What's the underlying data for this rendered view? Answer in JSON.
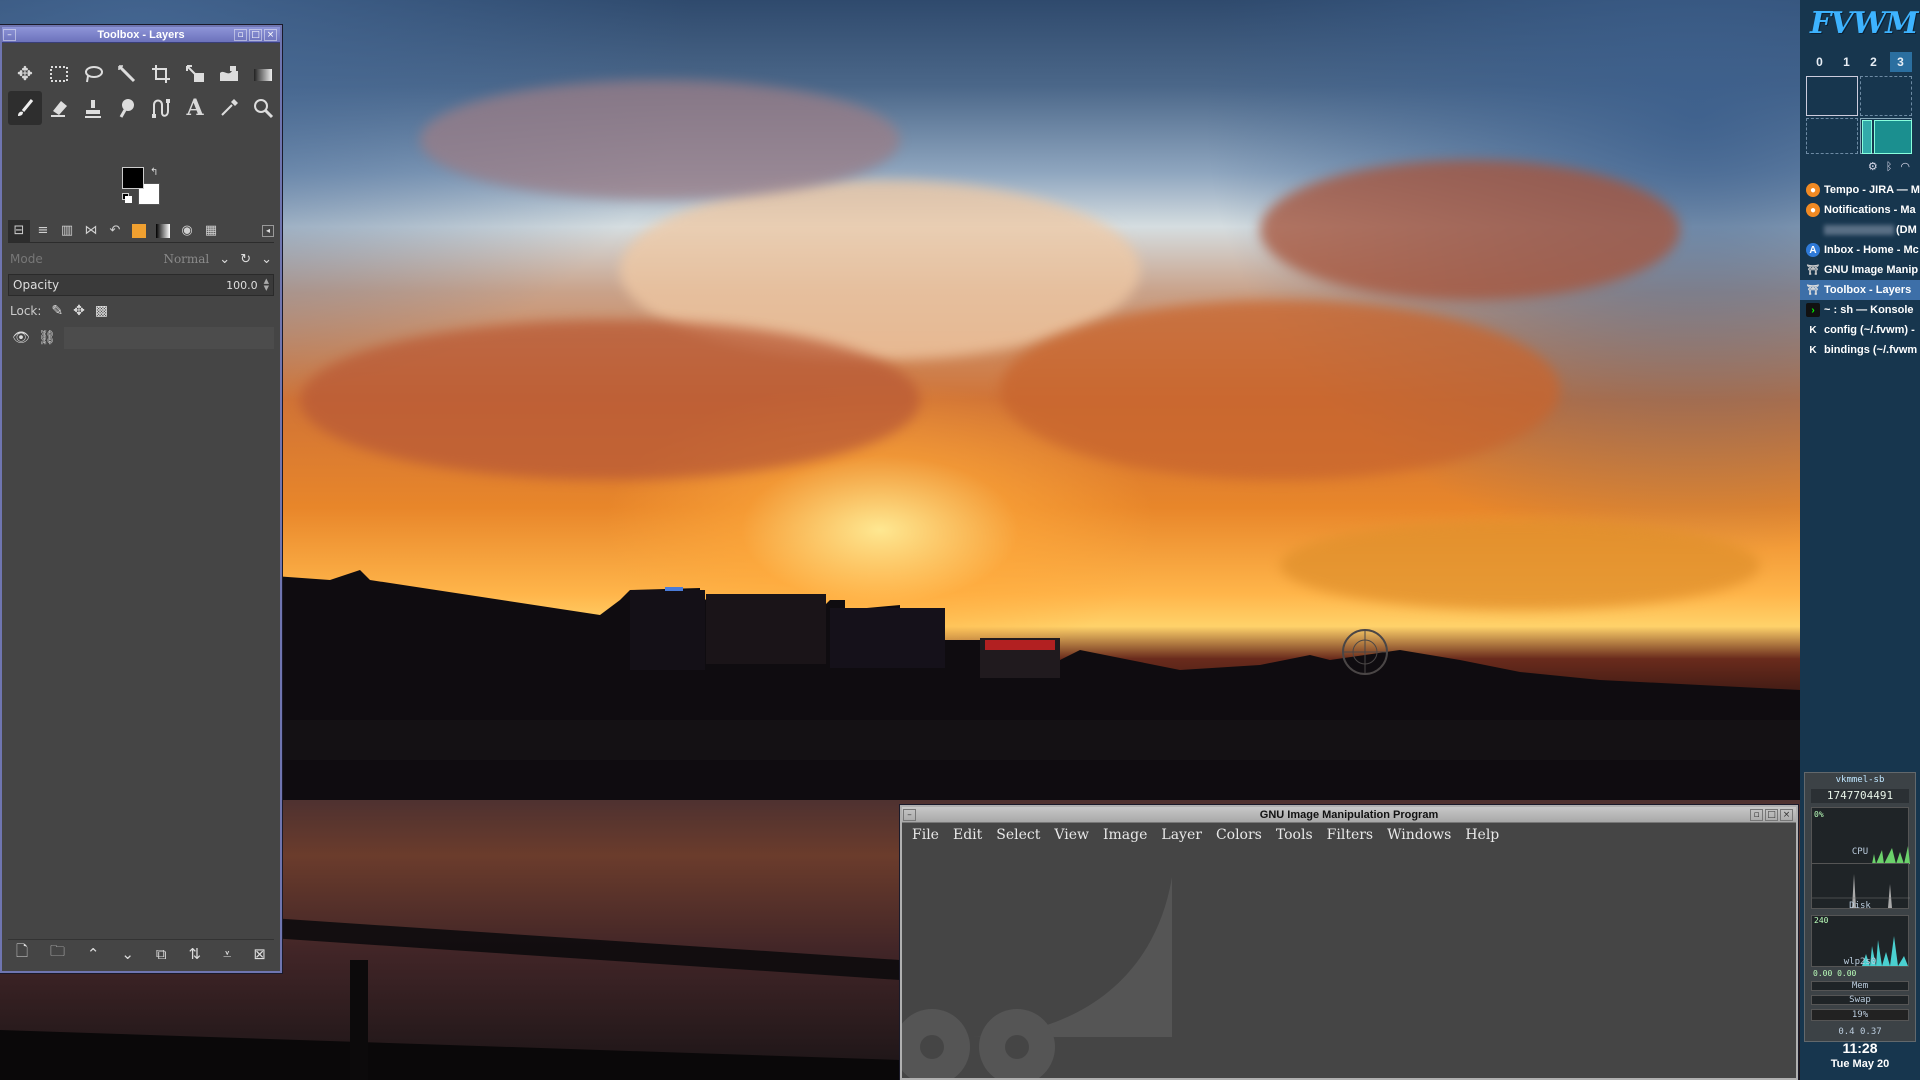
{
  "toolbox": {
    "title": "Toolbox - Layers",
    "mode_label": "Mode",
    "mode_value": "Normal",
    "opacity_label": "Opacity",
    "opacity_value": "100.0",
    "lock_label": "Lock:",
    "colors": {
      "foreground": "#000000",
      "background": "#ffffff"
    }
  },
  "gimp_window": {
    "title": "GNU Image Manipulation Program",
    "menu": [
      "File",
      "Edit",
      "Select",
      "View",
      "Image",
      "Layer",
      "Colors",
      "Tools",
      "Filters",
      "Windows",
      "Help"
    ]
  },
  "panel": {
    "logo": "FVWM",
    "desks": [
      "0",
      "1",
      "2",
      "3"
    ],
    "active_desk": "3",
    "tasks": [
      {
        "name": "Tempo - JIRA — M",
        "icon": "firefox-icon"
      },
      {
        "name": "Notifications - Ma",
        "icon": "firefox-icon"
      },
      {
        "name": "(DM",
        "icon": "blurred"
      },
      {
        "name": "Inbox - Home - Mc",
        "icon": "thunderbird-icon"
      },
      {
        "name": "GNU Image Manip",
        "icon": "gimp-icon"
      },
      {
        "name": "Toolbox - Layers",
        "icon": "gimp-icon",
        "active": true
      },
      {
        "name": "~ : sh — Konsole",
        "icon": "terminal-icon"
      },
      {
        "name": "config (~/.fvwm) -",
        "icon": "kate-icon"
      },
      {
        "name": "bindings (~/.fvwm",
        "icon": "kate-icon"
      }
    ],
    "sysmon": {
      "host": "vkmmel-sb",
      "uptime": "1747704491",
      "cpu_top": "0%",
      "cpu_label": "CPU",
      "disk_label": "Disk",
      "disk_val": "240",
      "net_label": "wlp2s0",
      "net_val": "0.00 0.00",
      "mem_label": "Mem",
      "swap_label": "Swap",
      "swap_val": "19%",
      "load": "0.4 0.37"
    },
    "clock": "11:28",
    "date": "Tue May 20"
  }
}
